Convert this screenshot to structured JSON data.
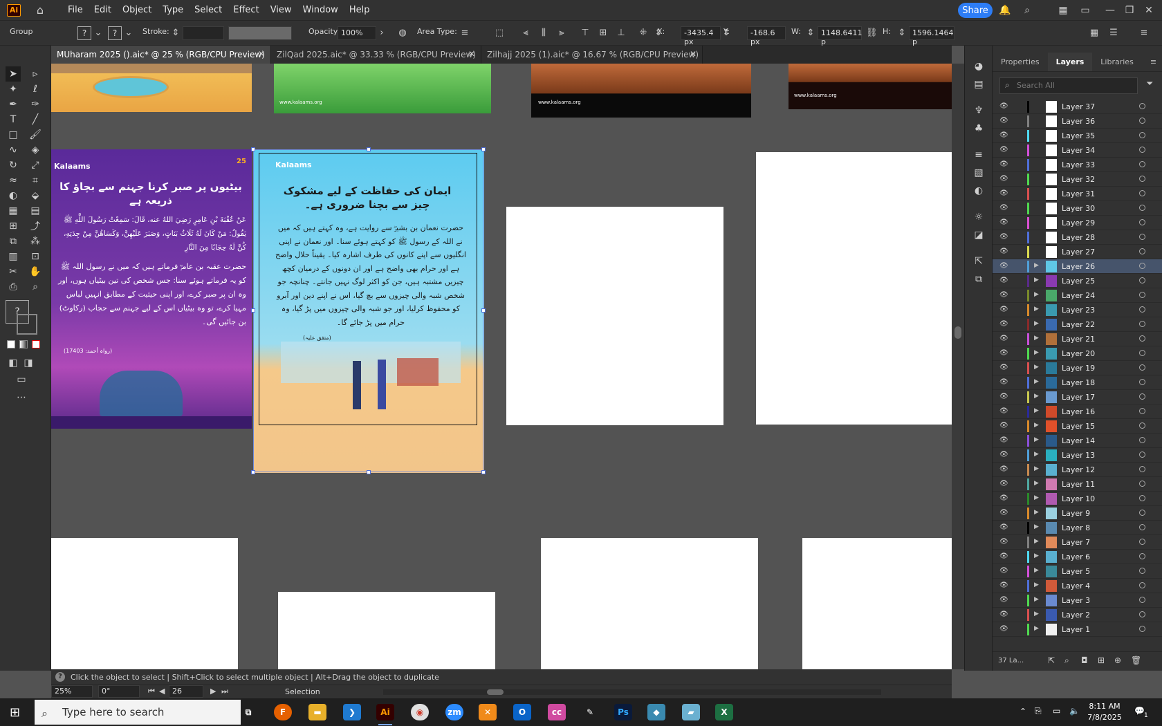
{
  "menubar": {
    "app_logo": "Ai",
    "items": [
      "File",
      "Edit",
      "Object",
      "Type",
      "Select",
      "Effect",
      "View",
      "Window",
      "Help"
    ],
    "share_label": "Share"
  },
  "control": {
    "selection_type": "Group",
    "stroke_label": "Stroke:",
    "opacity_label": "Opacity:",
    "opacity_value": "100%",
    "area_type_label": "Area Type:",
    "x_label": "X:",
    "x_value": "-3435.4 px",
    "y_label": "Y:",
    "y_value": "-168.6 px",
    "w_label": "W:",
    "w_value": "1148.6411 p",
    "h_label": "H:",
    "h_value": "1596.1464 p",
    "q_label": "?"
  },
  "tabs": [
    {
      "label": "MUharam 2025 ().aic* @ 25 % (RGB/CPU Preview)",
      "active": true
    },
    {
      "label": "ZilQad 2025.aic* @ 33.33 % (RGB/CPU Preview)",
      "active": false
    },
    {
      "label": "Zilhajj 2025 (1).aic* @ 16.67 % (RGB/CPU Preview)",
      "active": false
    }
  ],
  "artboards": {
    "web_label": "www.kalaams.org",
    "left_card": {
      "brand": "Kalaams",
      "badge": "25",
      "title": "بیٹیوں پر صبر کرنا جہنم سے بچاؤ کا ذریعہ ہے",
      "arabic": "عَنْ عُقْبَةَ بْنِ عَامِرٍ رَضِيَ اللهُ عنه، قَالَ: سَمِعْتُ رَسُولَ اللَّهِ ﷺ يَقُولُ: مَنْ كَانَ لَهُ ثَلَاثُ بَنَاتٍ، وَصَبَرَ عَلَيْهِنَّ، وَكَسَاهُنَّ مِنْ جِدَتِهِ، كُنَّ لَهُ حِجَابًا مِنَ النَّارِ",
      "urdu": "حضرت عقبہ بن عامرؓ فرماتے ہیں کہ میں نے رسول اللہ ﷺ کو یہ فرماتے ہوئے سنا: جس شخص کی تین بیٹیاں ہوں، اور وہ ان پر صبر کرے، اور اپنی حیثیت کے مطابق انہیں لباس مہیا کرے، تو وہ بیٹیاں اس کے لیے جہنم سے حجاب (رکاوٹ) بن جائیں گی۔",
      "ref": "(رواہ أحمد: 17403)"
    },
    "center_card": {
      "brand": "Kalaams",
      "title": "ایمان کی حفاظت کے لیے مشکوک چیز سے بچنا ضروری ہے۔",
      "body": "حضرت نعمان بن بشیرؓ سے روایت ہے، وہ کہتے ہیں کہ میں نے اللہ کے رسول ﷺ کو کہتے ہوئے سنا۔ اور نعمان نے اپنی انگلیوں سے اپنے کانوں کی طرف اشارہ کیا۔ یقیناً حلال واضح ہے اور حرام بھی واضح ہے اور ان دونوں کے درمیان کچھ چیزیں مشتبہ ہیں، جن کو اکثر لوگ نہیں جانتے۔ چنانچہ جو شخص شبہ والی چیزوں سے بچ گیا، اس نے اپنے دین اور آبرو کو محفوظ کرلیا، اور جو شبہ والی چیزوں میں پڑ گیا، وہ حرام میں پڑ جائے گا۔",
      "ref": "(متفق علیہ)"
    }
  },
  "panel": {
    "tabs": [
      "Properties",
      "Layers",
      "Libraries"
    ],
    "search_placeholder": "Search All",
    "layers": [
      {
        "name": "Layer 37",
        "color": "#000000",
        "expand": false,
        "thumb": "#ffffff"
      },
      {
        "name": "Layer 36",
        "color": "#808080",
        "expand": false,
        "thumb": "#ffffff"
      },
      {
        "name": "Layer 35",
        "color": "#4fd9f0",
        "expand": false,
        "thumb": "#ffffff"
      },
      {
        "name": "Layer 34",
        "color": "#d24fd9",
        "expand": false,
        "thumb": "#ffffff"
      },
      {
        "name": "Layer 33",
        "color": "#4f6fd9",
        "expand": false,
        "thumb": "#ffffff"
      },
      {
        "name": "Layer 32",
        "color": "#4fd94f",
        "expand": false,
        "thumb": "#ffffff"
      },
      {
        "name": "Layer 31",
        "color": "#d94f4f",
        "expand": false,
        "thumb": "#ffffff"
      },
      {
        "name": "Layer 30",
        "color": "#4fd94f",
        "expand": false,
        "thumb": "#ffffff"
      },
      {
        "name": "Layer 29",
        "color": "#d94fd2",
        "expand": false,
        "thumb": "#ffffff"
      },
      {
        "name": "Layer 28",
        "color": "#4f6fd9",
        "expand": false,
        "thumb": "#ffffff"
      },
      {
        "name": "Layer 27",
        "color": "#d9d94f",
        "expand": false,
        "thumb": "#ffffff"
      },
      {
        "name": "Layer 26",
        "color": "#4f9fd9",
        "expand": true,
        "thumb": "#5fc7e6",
        "selected": true
      },
      {
        "name": "Layer 25",
        "color": "#5a2a8a",
        "expand": true,
        "thumb": "#8a3ab0"
      },
      {
        "name": "Layer 24",
        "color": "#7a8a2a",
        "expand": true,
        "thumb": "#4aa86a"
      },
      {
        "name": "Layer 23",
        "color": "#d98a2a",
        "expand": true,
        "thumb": "#3a9ab0"
      },
      {
        "name": "Layer 22",
        "color": "#8a2a2a",
        "expand": true,
        "thumb": "#3a6ab0"
      },
      {
        "name": "Layer 21",
        "color": "#c84fd9",
        "expand": true,
        "thumb": "#b0703a"
      },
      {
        "name": "Layer 20",
        "color": "#4fd94f",
        "expand": true,
        "thumb": "#3a9ab0"
      },
      {
        "name": "Layer 19",
        "color": "#d94f4f",
        "expand": true,
        "thumb": "#2a7a9a"
      },
      {
        "name": "Layer 18",
        "color": "#4f6fd9",
        "expand": true,
        "thumb": "#2a6a9a"
      },
      {
        "name": "Layer 17",
        "color": "#c8c84f",
        "expand": true,
        "thumb": "#6a9ad0"
      },
      {
        "name": "Layer 16",
        "color": "#2a2a9a",
        "expand": true,
        "thumb": "#d04a2a"
      },
      {
        "name": "Layer 15",
        "color": "#d98a2a",
        "expand": true,
        "thumb": "#e0502a"
      },
      {
        "name": "Layer 14",
        "color": "#8a4fd9",
        "expand": true,
        "thumb": "#2a5a8a"
      },
      {
        "name": "Layer 13",
        "color": "#4f9fd9",
        "expand": true,
        "thumb": "#2ab0c0"
      },
      {
        "name": "Layer 12",
        "color": "#c88a4f",
        "expand": true,
        "thumb": "#5ab0d0"
      },
      {
        "name": "Layer 11",
        "color": "#4fa8a0",
        "expand": true,
        "thumb": "#d07ab0"
      },
      {
        "name": "Layer 10",
        "color": "#2a8a2a",
        "expand": true,
        "thumb": "#b05ab0"
      },
      {
        "name": "Layer 9",
        "color": "#d98a2a",
        "expand": true,
        "thumb": "#9ad0e0"
      },
      {
        "name": "Layer 8",
        "color": "#000000",
        "expand": true,
        "thumb": "#5a8ab0"
      },
      {
        "name": "Layer 7",
        "color": "#808080",
        "expand": true,
        "thumb": "#e08a5a"
      },
      {
        "name": "Layer 6",
        "color": "#4fd9f0",
        "expand": true,
        "thumb": "#5ab0d0"
      },
      {
        "name": "Layer 5",
        "color": "#d24fd9",
        "expand": true,
        "thumb": "#3a8a9a"
      },
      {
        "name": "Layer 4",
        "color": "#4f6fd9",
        "expand": true,
        "thumb": "#d05a3a"
      },
      {
        "name": "Layer 3",
        "color": "#4fd94f",
        "expand": true,
        "thumb": "#6a8ad0"
      },
      {
        "name": "Layer 2",
        "color": "#d94f4f",
        "expand": true,
        "thumb": "#3a5ab0"
      },
      {
        "name": "Layer 1",
        "color": "#4fd94f",
        "expand": true,
        "thumb": "#f0f0f0"
      }
    ],
    "footer_count": "37 La..."
  },
  "status": {
    "hint": "Click the object to select  |  Shift+Click to select multiple object  |  Alt+Drag the object to duplicate",
    "zoom": "25%",
    "rotation": "0°",
    "artboard": "26",
    "tool": "Selection"
  },
  "taskbar": {
    "search_placeholder": "Type here to search",
    "time": "8:11 AM",
    "date": "7/8/2025",
    "notif": "1"
  },
  "colors": {
    "accent": "#2d7df6",
    "selection": "#4f6fd9",
    "layer_selected_bg": "#46546b"
  }
}
